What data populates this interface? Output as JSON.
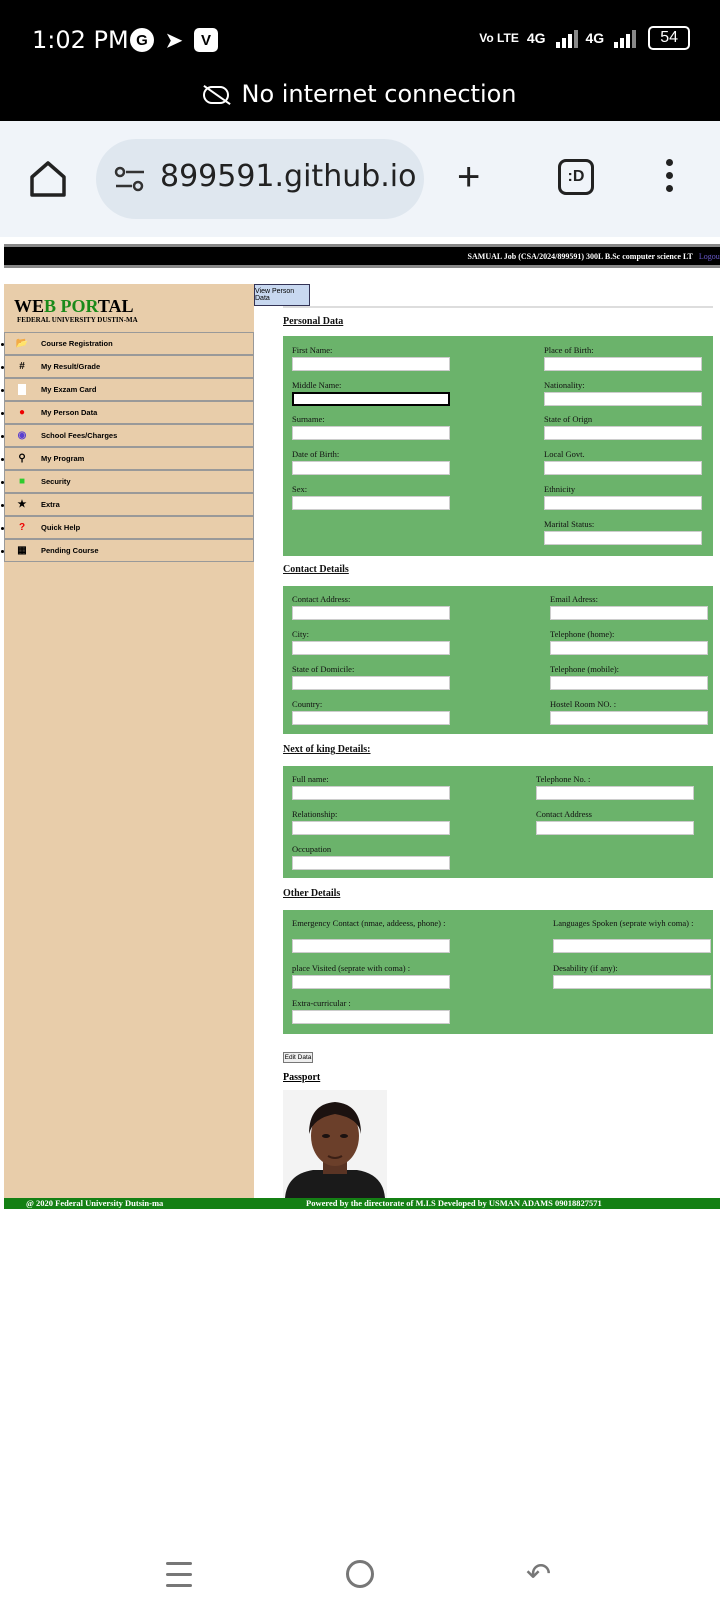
{
  "status_bar": {
    "time": "1:02 PM",
    "volte": "Vo LTE",
    "net1": "4G",
    "net2": "4G",
    "battery": "54",
    "notice": "No internet connection"
  },
  "browser": {
    "url": "899591.github.io",
    "tabs_label": ":D"
  },
  "top_band": {
    "student": "SAMUAL Job (CSA/2024/899591) 300L B.Sc computer science LT",
    "logout": "Logout"
  },
  "sidebar": {
    "logo_a": "WE",
    "logo_b": "B POR",
    "logo_c": "TAL",
    "subtitle": "FEDERAL UNIVERSITY DUSTIN-MA",
    "items": [
      {
        "label": "Course Registration",
        "icon": "folder-open-icon"
      },
      {
        "label": "My Result/Grade",
        "icon": "hashtag-icon"
      },
      {
        "label": "My Exzam Card",
        "icon": "file-icon"
      },
      {
        "label": "My Person Data",
        "icon": "user-icon"
      },
      {
        "label": "School Fees/Charges",
        "icon": "coins-icon"
      },
      {
        "label": "My Program",
        "icon": "search-icon"
      },
      {
        "label": "Security",
        "icon": "unlock-icon"
      },
      {
        "label": "Extra",
        "icon": "star-icon"
      },
      {
        "label": "Quick Help",
        "icon": "question-icon"
      },
      {
        "label": "Pending Course",
        "icon": "calendar-icon"
      }
    ]
  },
  "view_button": "View Person Data",
  "personal": {
    "title": "Personal Data",
    "left": [
      "First Name:",
      "Middle Name:",
      "Surname:",
      "Date of Birth:",
      "Sex:"
    ],
    "right": [
      "Place of Birth:",
      "Nationality:",
      "State of Orign",
      "Local Govt.",
      "Ethnicity",
      "Marital Status:"
    ]
  },
  "contact": {
    "title": "Contact Details",
    "left": [
      "Contact Address:",
      "City:",
      "State of Domicile:",
      "Country:"
    ],
    "right": [
      "Email Adress:",
      "Telephone (home):",
      "Telephone (mobile):",
      "Hostel Room NO. :"
    ]
  },
  "kin": {
    "title": "Next of king Details:",
    "left": [
      "Full name:",
      "Relationship:",
      "Occupation"
    ],
    "right": [
      "Telephone No. :",
      "Contact Address"
    ]
  },
  "other": {
    "title": "Other Details",
    "left": [
      "Emergency Contact (nmae, addeess, phone) :",
      "place Visited (seprate with coma) :",
      "Extra-curricular :"
    ],
    "right": [
      "Languages Spoken (seprate wiyh coma) :",
      "Desability (if any):"
    ]
  },
  "edit_button": "Edit Data",
  "passport_title": "Passport",
  "footer": {
    "left": "@ 2020 Federal University Dutsin-ma",
    "right": "Powered by the directorate of  M.I.S   Developed   by    USMAN ADAMS   09018827571"
  }
}
